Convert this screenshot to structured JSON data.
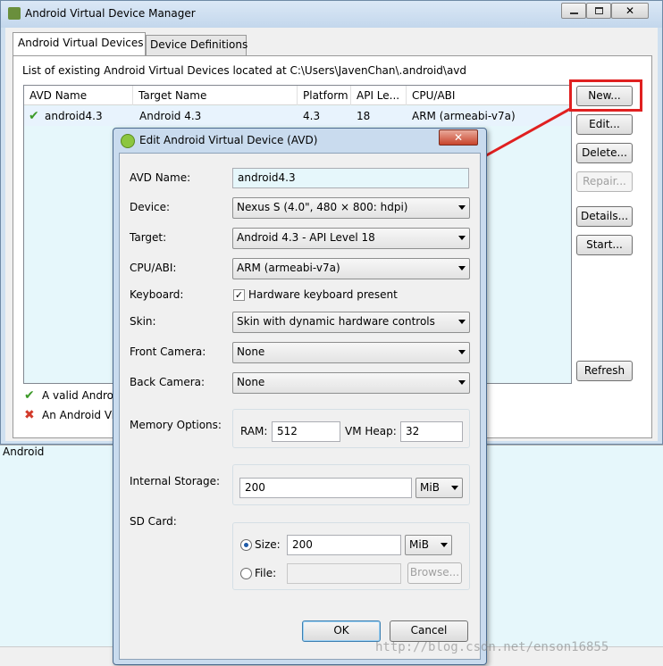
{
  "manager": {
    "title": "Android Virtual Device Manager",
    "tabs": [
      "Android Virtual Devices",
      "Device Definitions"
    ],
    "list_caption": "List of existing Android Virtual Devices located at C:\\Users\\JavenChan\\.android\\avd",
    "columns": [
      "AVD Name",
      "Target Name",
      "Platform",
      "API Le...",
      "CPU/ABI"
    ],
    "rows": [
      {
        "name": "android4.3",
        "target": "Android 4.3",
        "platform": "4.3",
        "api": "18",
        "cpu": "ARM (armeabi-v7a)"
      }
    ],
    "buttons": {
      "new": "New...",
      "edit": "Edit...",
      "delete": "Delete...",
      "repair": "Repair...",
      "details": "Details...",
      "start": "Start...",
      "refresh": "Refresh"
    },
    "legend": {
      "valid": "A valid Andro",
      "invalid": "An Android Vi"
    }
  },
  "background": {
    "panel_label": "Android"
  },
  "dialog": {
    "title": "Edit Android Virtual Device (AVD)",
    "labels": {
      "avd_name": "AVD Name:",
      "device": "Device:",
      "target": "Target:",
      "cpu": "CPU/ABI:",
      "keyboard": "Keyboard:",
      "skin": "Skin:",
      "front_camera": "Front Camera:",
      "back_camera": "Back Camera:",
      "memory": "Memory Options:",
      "internal": "Internal Storage:",
      "sdcard": "SD Card:",
      "ram": "RAM:",
      "vmheap": "VM Heap:",
      "size": "Size:",
      "file": "File:"
    },
    "values": {
      "avd_name": "android4.3",
      "device": "Nexus S (4.0\", 480 × 800: hdpi)",
      "target": "Android 4.3 - API Level 18",
      "cpu": "ARM (armeabi-v7a)",
      "keyboard_text": "Hardware keyboard present",
      "skin": "Skin with dynamic hardware controls",
      "front_camera": "None",
      "back_camera": "None",
      "ram": "512",
      "vmheap": "32",
      "internal": "200",
      "internal_unit": "MiB",
      "sd_size": "200",
      "sd_unit": "MiB",
      "sd_file": ""
    },
    "buttons": {
      "browse": "Browse...",
      "ok": "OK",
      "cancel": "Cancel"
    }
  },
  "watermark": "http://blog.csdn.net/enson16855",
  "colors": {
    "highlight": "#e02020",
    "row_selected": "#e8f3fd",
    "list_bg": "#e6f7fb"
  }
}
